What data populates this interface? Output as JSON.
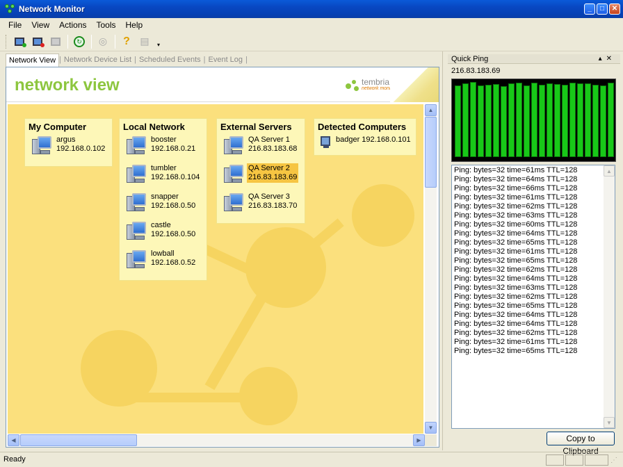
{
  "window": {
    "title": "Network Monitor"
  },
  "menu": [
    {
      "label": "File"
    },
    {
      "label": "View"
    },
    {
      "label": "Actions"
    },
    {
      "label": "Tools"
    },
    {
      "label": "Help"
    }
  ],
  "toolbar": {
    "buttons": [
      "add-device-icon",
      "remove-device-icon",
      "device-properties-icon",
      "refresh-icon",
      "ping-icon",
      "help-icon",
      "print-icon"
    ]
  },
  "tabs": [
    {
      "label": "Network View",
      "active": true
    },
    {
      "label": "Network Device List"
    },
    {
      "label": "Scheduled Events"
    },
    {
      "label": "Event Log"
    }
  ],
  "banner": {
    "heading": "network view",
    "logo_name": "tembria",
    "logo_sub": "network monitor™"
  },
  "groups": [
    {
      "title": "My Computer",
      "devices": [
        {
          "name": "argus",
          "ip": "192.168.0.102"
        }
      ]
    },
    {
      "title": "Local Network",
      "devices": [
        {
          "name": "booster",
          "ip": "192.168.0.21"
        },
        {
          "name": "tumbler",
          "ip": "192.168.0.104"
        },
        {
          "name": "snapper",
          "ip": "192.168.0.50"
        },
        {
          "name": "castle",
          "ip": "192.168.0.50"
        },
        {
          "name": "lowball",
          "ip": "192.168.0.52"
        }
      ]
    },
    {
      "title": "External Servers",
      "devices": [
        {
          "name": "QA Server 1",
          "ip": "216.83.183.68"
        },
        {
          "name": "QA Server 2",
          "ip": "216.83.183.69",
          "selected": true
        },
        {
          "name": "QA Server 3",
          "ip": "216.83.183.70"
        }
      ]
    },
    {
      "title": "Detected Computers",
      "devices": [
        {
          "label": "badger 192.168.0.101"
        }
      ]
    }
  ],
  "quick_ping": {
    "title": "Quick Ping",
    "host": "216.83.183.69",
    "times_ms": [
      61,
      64,
      66,
      61,
      62,
      63,
      60,
      64,
      65,
      61,
      65,
      62,
      64,
      63,
      62,
      65,
      64,
      64,
      62,
      61,
      65
    ],
    "log": [
      "Ping: bytes=32 time=61ms TTL=128",
      "Ping: bytes=32 time=64ms TTL=128",
      "Ping: bytes=32 time=66ms TTL=128",
      "Ping: bytes=32 time=61ms TTL=128",
      "Ping: bytes=32 time=62ms TTL=128",
      "Ping: bytes=32 time=63ms TTL=128",
      "Ping: bytes=32 time=60ms TTL=128",
      "Ping: bytes=32 time=64ms TTL=128",
      "Ping: bytes=32 time=65ms TTL=128",
      "Ping: bytes=32 time=61ms TTL=128",
      "Ping: bytes=32 time=65ms TTL=128",
      "Ping: bytes=32 time=62ms TTL=128",
      "Ping: bytes=32 time=64ms TTL=128",
      "Ping: bytes=32 time=63ms TTL=128",
      "Ping: bytes=32 time=62ms TTL=128",
      "Ping: bytes=32 time=65ms TTL=128",
      "Ping: bytes=32 time=64ms TTL=128",
      "Ping: bytes=32 time=64ms TTL=128",
      "Ping: bytes=32 time=62ms TTL=128",
      "Ping: bytes=32 time=61ms TTL=128",
      "Ping: bytes=32 time=65ms TTL=128"
    ],
    "copy_label": "Copy to Clipboard"
  },
  "status": {
    "text": "Ready"
  },
  "colors": {
    "accent": "#8dc63f",
    "canvas": "#fbe07d",
    "group": "#fdf7b8",
    "selected": "#f6c542",
    "ping_bar": "#18c818"
  }
}
